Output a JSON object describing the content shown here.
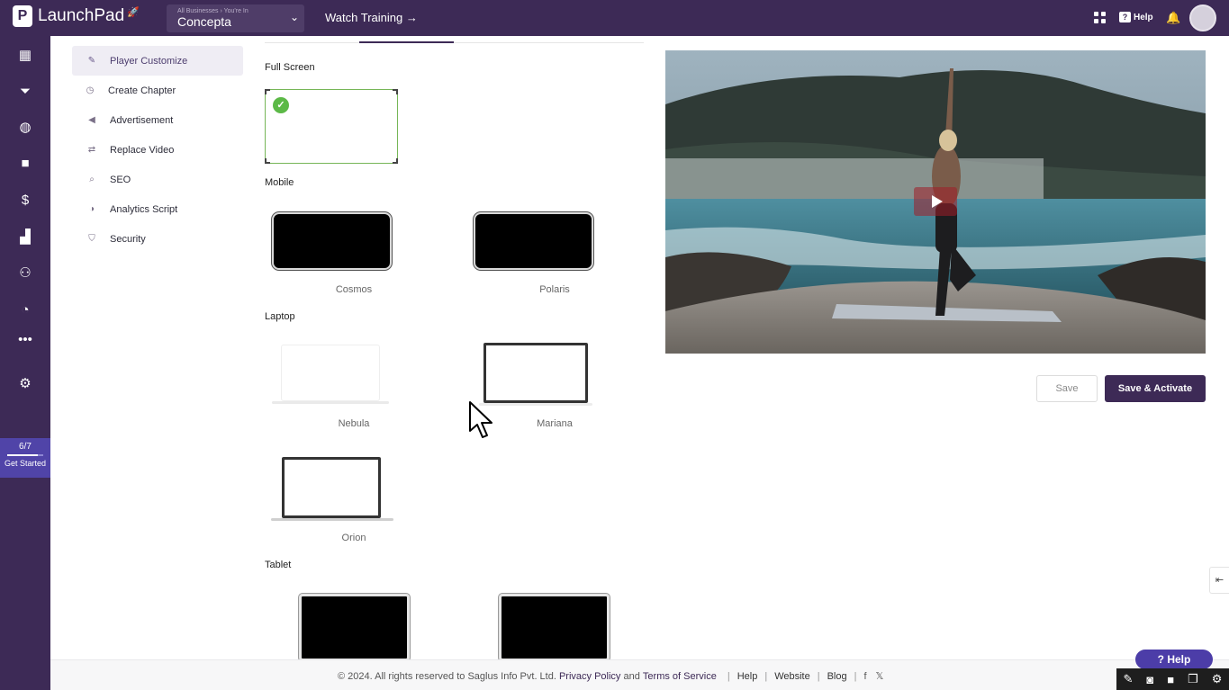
{
  "topbar": {
    "brand": "LaunchPad",
    "business_caption": "All Businesses › You're In",
    "business_name": "Concepta",
    "watch_training": "Watch Training →",
    "help_label": "Help"
  },
  "rail": {
    "icons": [
      "dashboard-icon",
      "funnel-icon",
      "globe-icon",
      "video-camera-icon",
      "dollar-icon",
      "analytics-icon",
      "users-icon",
      "history-icon",
      "more-icon",
      "settings-icon"
    ],
    "progress_text": "6/7",
    "progress_fraction": 0.857,
    "get_started": "Get Started"
  },
  "menu": {
    "items": [
      {
        "label": "Player Customize",
        "icon": "palette-icon",
        "active": true
      },
      {
        "label": "Create Chapter",
        "icon": "timer-icon",
        "active": false
      },
      {
        "label": "Advertisement",
        "icon": "megaphone-icon",
        "active": false
      },
      {
        "label": "Replace Video",
        "icon": "swap-icon",
        "active": false
      },
      {
        "label": "SEO",
        "icon": "search-icon",
        "active": false
      },
      {
        "label": "Analytics Script",
        "icon": "chart-icon",
        "active": false
      },
      {
        "label": "Security",
        "icon": "shield-icon",
        "active": false
      }
    ]
  },
  "skins": {
    "fullscreen_title": "Full Screen",
    "mobile_title": "Mobile",
    "mobile": [
      "Cosmos",
      "Polaris"
    ],
    "laptop_title": "Laptop",
    "laptop": [
      "Nebula",
      "Mariana",
      "Orion"
    ],
    "tablet_title": "Tablet"
  },
  "actions": {
    "save": "Save",
    "save_activate": "Save & Activate"
  },
  "footer": {
    "copyright": "©  2024. All rights reserved to Saglus Info Pvt. Ltd.",
    "privacy": "Privacy Policy",
    "and": "and",
    "terms": "Terms of Service",
    "help": "Help",
    "website": "Website",
    "blog": "Blog",
    "facebook": "f",
    "x": "𝕏"
  },
  "help_fab": "? Help",
  "colors": {
    "brand": "#3d2a56",
    "accent": "#5044a8",
    "selected_border": "#76b657",
    "check": "#5cb947"
  }
}
